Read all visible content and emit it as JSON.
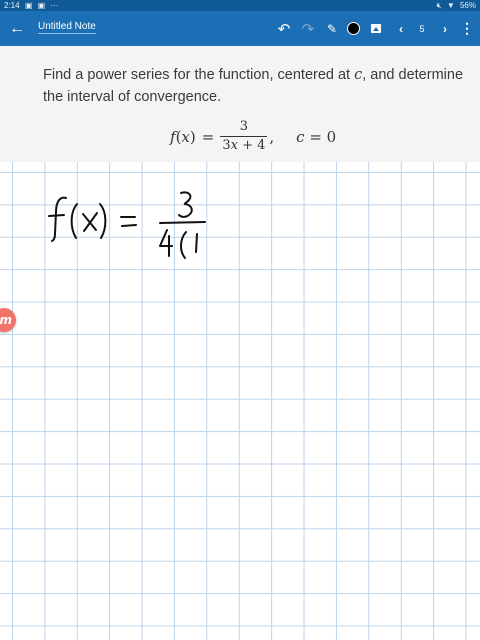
{
  "status_bar": {
    "time": "2:14",
    "left_icons": [
      "image-notification-icon",
      "gallery-notification-icon",
      "more-notifications-icon"
    ],
    "more_indicator": "···",
    "right_icons": [
      "mute-icon",
      "wifi-icon"
    ],
    "battery": "56%"
  },
  "toolbar": {
    "back_icon": "arrow-left-icon",
    "title": "Untitled Note",
    "undo_icon": "undo-icon",
    "redo_icon": "redo-icon",
    "pen_icon": "pen-icon",
    "color_icon": "color-dot-icon",
    "image_icon": "image-icon",
    "prev_icon": "chevron-left-icon",
    "page_number": "5",
    "next_icon": "chevron-right-icon",
    "more_icon": "more-vertical-icon"
  },
  "problem": {
    "line1_prefix": "Find a power series for the function, centered at ",
    "line1_var": "c",
    "line1_suffix": ", and determine",
    "line2": "the interval of convergence.",
    "equation": {
      "lhs_f": "f",
      "lhs_open": "(",
      "lhs_x": "x",
      "lhs_close": ")",
      "equals": "=",
      "numerator": "3",
      "denominator_coef": "3",
      "denominator_var": "x",
      "denominator_rest": " + 4",
      "comma": ",",
      "cond_var": "c",
      "cond_rest": " = 0"
    }
  },
  "handwriting": {
    "description_text": "f(x) = 3 / 4(1"
  },
  "side_badge": {
    "label": "m"
  },
  "colors": {
    "status_bar": "#0f5a97",
    "toolbar": "#1d6fb5",
    "grid_line": "#bcd3ea",
    "ink": "#111111",
    "badge": "#f0746a"
  }
}
